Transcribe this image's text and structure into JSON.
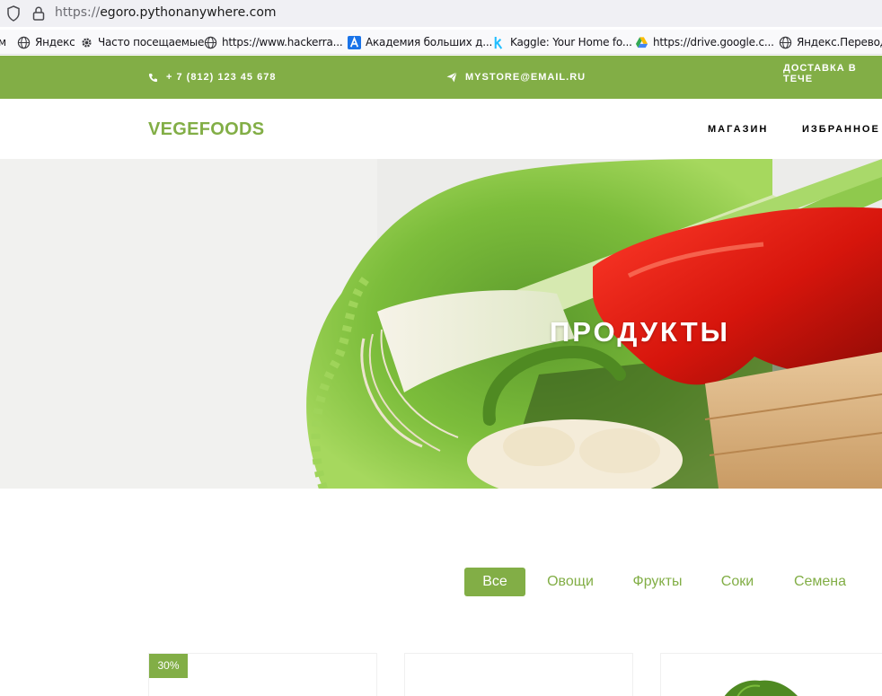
{
  "browser": {
    "url_scheme": "https://",
    "url_host": "egoro.pythonanywhere.com",
    "bookmarks": [
      {
        "label": "м",
        "icon": "partial-icon"
      },
      {
        "label": "Яндекс",
        "icon": "globe-icon"
      },
      {
        "label": "Часто посещаемые",
        "icon": "gear-icon"
      },
      {
        "label": "https://www.hackerra...",
        "icon": "globe-icon"
      },
      {
        "label": "Академия больших д...",
        "icon": "a-logo-icon"
      },
      {
        "label": "Kaggle: Your Home fo...",
        "icon": "kaggle-icon"
      },
      {
        "label": "https://drive.google.c...",
        "icon": "google-drive-icon"
      },
      {
        "label": "Яндекс.Переводч",
        "icon": "globe-icon"
      }
    ]
  },
  "topbar": {
    "phone": "+ 7 (812) 123 45 678",
    "email": "MYSTORE@EMAIL.RU",
    "delivery": "ДОСТАВКА В ТЕЧЕ"
  },
  "navbar": {
    "brand": "VEGEFOODS",
    "links": [
      "МАГАЗИН",
      "ИЗБРАННОЕ"
    ]
  },
  "hero": {
    "title": "ПРОДУКТЫ"
  },
  "filters": {
    "items": [
      "Все",
      "Овощи",
      "Фрукты",
      "Соки",
      "Семена"
    ],
    "active": "Все"
  },
  "products": [
    {
      "badge": "30%"
    },
    {
      "badge": ""
    },
    {
      "badge": ""
    }
  ],
  "colors": {
    "accent": "#82ae46",
    "text_dark": "#000000",
    "white": "#ffffff"
  }
}
